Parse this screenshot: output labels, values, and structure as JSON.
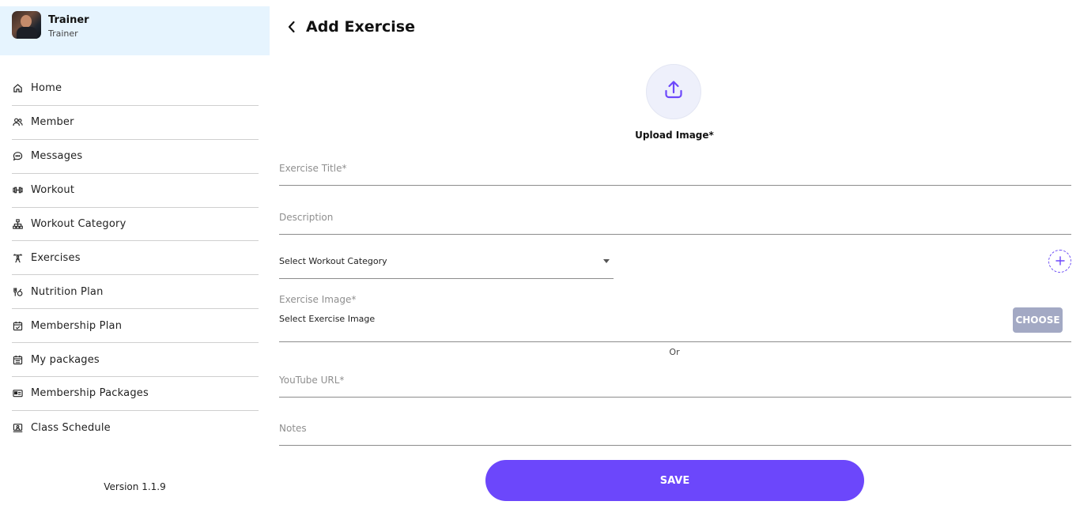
{
  "profile": {
    "name": "Trainer",
    "role": "Trainer"
  },
  "sidebar": {
    "items": [
      {
        "label": "Home",
        "icon": "home-icon"
      },
      {
        "label": "Member",
        "icon": "users-icon"
      },
      {
        "label": "Messages",
        "icon": "chat-icon"
      },
      {
        "label": "Workout",
        "icon": "dumbbell-icon"
      },
      {
        "label": "Workout Category",
        "icon": "hierarchy-icon"
      },
      {
        "label": "Exercises",
        "icon": "exercise-icon"
      },
      {
        "label": "Nutrition Plan",
        "icon": "nutrition-icon"
      },
      {
        "label": "Membership Plan",
        "icon": "calendar-check-icon"
      },
      {
        "label": "My packages",
        "icon": "calendar-list-icon"
      },
      {
        "label": "Membership Packages",
        "icon": "card-icon"
      },
      {
        "label": "Class Schedule",
        "icon": "monitor-user-icon"
      }
    ],
    "version": "Version 1.1.9"
  },
  "header": {
    "title": "Add Exercise"
  },
  "form": {
    "upload_label": "Upload Image*",
    "title_placeholder": "Exercise Title*",
    "description_placeholder": "Description",
    "category_value": "Select Workout Category",
    "image_label": "Exercise Image*",
    "image_sub": "Select Exercise Image",
    "choose_label": "CHOOSE",
    "or_text": "Or",
    "youtube_placeholder": "YouTube URL*",
    "notes_placeholder": "Notes",
    "save_label": "SAVE"
  },
  "colors": {
    "accent": "#6c47fb",
    "profile_bg": "#e6f4fe",
    "choose_bg": "#a3a9c4"
  }
}
